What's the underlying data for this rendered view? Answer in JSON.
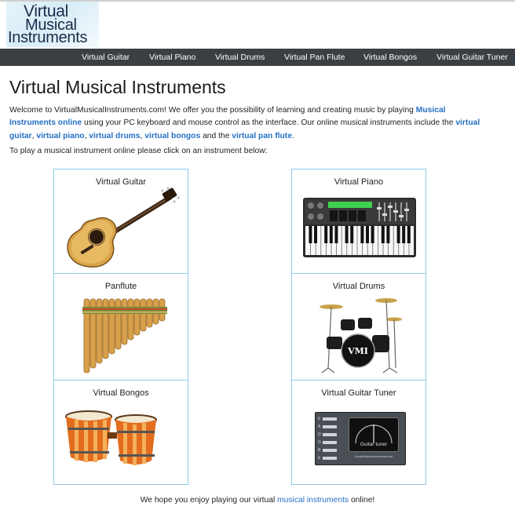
{
  "logo": {
    "line1": "Virtual",
    "line2": "Musical",
    "line3": "Instruments"
  },
  "nav": [
    "Virtual Guitar",
    "Virtual Piano",
    "Virtual Drums",
    "Virtual Pan Flute",
    "Virtual Bongos",
    "Virtual Guitar Tuner"
  ],
  "page_title": "Virtual Musical Instruments",
  "intro": {
    "t1": "Welcome to VirtualMusicalInstruments.com! We offer you the possibility of learning and creating music by playing ",
    "link_musical": "Musical Instruments online",
    "t2": " using your PC keyboard and mouse control as the interface. Our online musical instruments include the ",
    "link_guitar": "virtual guitar",
    "sep1": ", ",
    "link_piano": "virtual piano",
    "sep2": ", ",
    "link_drums": "virtual drums",
    "sep3": ", ",
    "link_bongos": "virtual bongos",
    "t3": " and the ",
    "link_flute": "virtual pan flute",
    "t4": "."
  },
  "prompt": "To play a musical instrument online please click on an instrument below:",
  "cards": {
    "guitar": "Virtual Guitar",
    "piano": "Virtual Piano",
    "panflute": "Panflute",
    "drums": "Virtual Drums",
    "bongos": "Virtual Bongos",
    "tuner": "Virtual Guitar Tuner"
  },
  "drum_logo": "VMI",
  "tuner_panel": {
    "strings": [
      "E",
      "A",
      "D",
      "G",
      "B",
      "E"
    ],
    "label": "Guitar tuner",
    "site": "VirtualMusicalInstruments.com"
  },
  "footer": {
    "t1": "We hope you enjoy playing our virtual ",
    "link": "musical instruments",
    "t2": " online!"
  },
  "colors": {
    "nav_bg": "#3a3f44",
    "link": "#2470c4",
    "card_border": "#8fc9e8"
  }
}
